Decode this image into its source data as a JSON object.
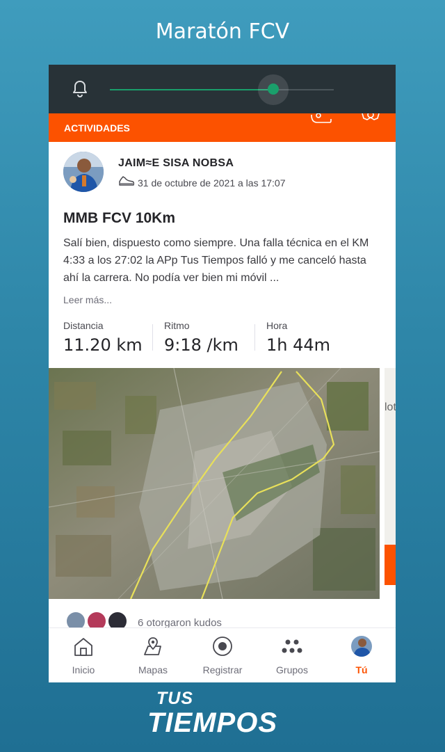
{
  "page": {
    "title": "Maratón FCV"
  },
  "notification_bar": {
    "slider_value": 0.73
  },
  "header": {
    "section_label": "ACTIVIDADES"
  },
  "activity": {
    "athlete_name": "JAIM≈E SISA NOBSA",
    "date": "31 de octubre de 2021 a las 17:07",
    "title": "MMB FCV 10Km",
    "description": "Salí bien,  dispuesto como siempre. Una falla técnica en el KM 4:33 a los 27:02 la APp Tus Tiempos falló  y me canceló hasta ahí la carrera. No podía ver bien mi móvil ...",
    "read_more": "Leer más...",
    "stats": [
      {
        "label": "Distancia",
        "value": "11.20 km"
      },
      {
        "label": "Ritmo",
        "value": "9:18 /km"
      },
      {
        "label": "Hora",
        "value": "1h 44m"
      }
    ],
    "map_side_text": "lot",
    "kudos_text": "6 otorgaron kudos"
  },
  "tabs": [
    {
      "label": "Inicio",
      "icon": "home-icon"
    },
    {
      "label": "Mapas",
      "icon": "map-icon"
    },
    {
      "label": "Registrar",
      "icon": "record-icon"
    },
    {
      "label": "Grupos",
      "icon": "groups-icon"
    },
    {
      "label": "Tú",
      "icon": "profile-avatar",
      "active": true
    }
  ],
  "brand": {
    "line1": "TUS",
    "line2": "TIEMPOS"
  },
  "colors": {
    "accent": "#fc5200",
    "route": "#e8e05a",
    "status_bar": "#283237",
    "slider": "#1a9f6b"
  }
}
